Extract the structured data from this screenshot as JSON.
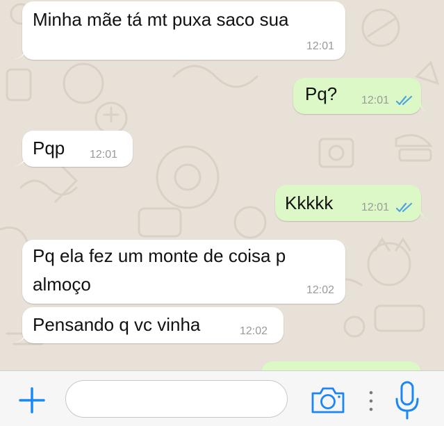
{
  "conversation": {
    "messages": [
      {
        "direction": "incoming",
        "text": "Minha mãe tá mt puxa saco sua",
        "time": "12:01"
      },
      {
        "direction": "outgoing",
        "text": "Pq?",
        "time": "12:01",
        "status": "read"
      },
      {
        "direction": "incoming",
        "text": "Pqp",
        "time": "12:01"
      },
      {
        "direction": "outgoing",
        "text": "Kkkkk",
        "time": "12:01",
        "status": "read"
      },
      {
        "direction": "incoming",
        "text_line1": "Pq ela fez um monte de coisa p",
        "text_line2": "almoço",
        "time": "12:02"
      },
      {
        "direction": "incoming",
        "text": "Pensando q vc vinha",
        "time": "12:02"
      }
    ]
  },
  "composer": {
    "input_value": "",
    "icons": [
      "plus-icon",
      "camera-icon",
      "more-icon",
      "microphone-icon"
    ]
  },
  "colors": {
    "incoming_bubble": "#ffffff",
    "outgoing_bubble": "#dcf8c6",
    "read_check": "#4fa3e0",
    "accent": "#1a87f4",
    "chat_background": "#e8e1d7"
  }
}
